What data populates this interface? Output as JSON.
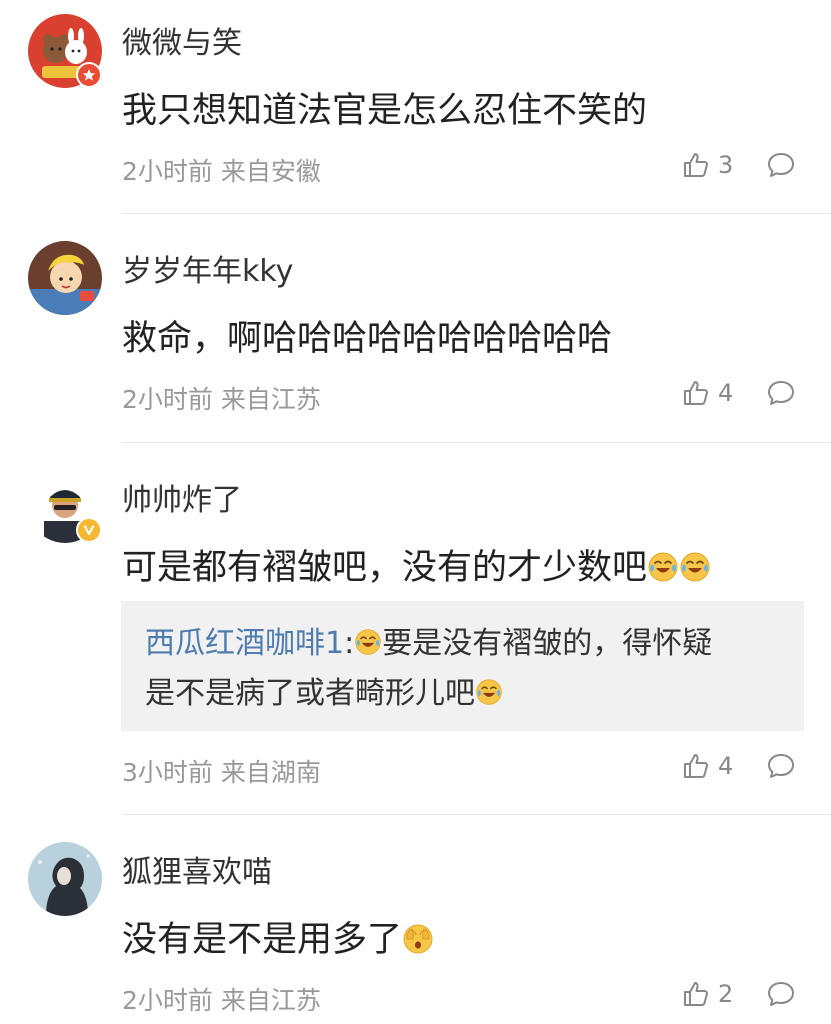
{
  "comments": [
    {
      "username": "微微与笑",
      "text": "我只想知道法官是怎么忍住不笑的",
      "time": "2小时前",
      "location": "来自安徽",
      "likes": "3",
      "avatar_icon": "bear-bunny-avatar",
      "badge_icon": "star-badge-icon",
      "badge_color": "#e94b35"
    },
    {
      "username": "岁岁年年kky",
      "text": "救命，啊哈哈哈哈哈哈哈哈哈哈",
      "time": "2小时前",
      "location": "来自江苏",
      "likes": "4",
      "avatar_icon": "cartoon-avatar"
    },
    {
      "username": "帅帅炸了",
      "text": "可是都有褶皱吧，没有的才少数吧",
      "time": "3小时前",
      "location": "来自湖南",
      "likes": "4",
      "avatar_icon": "police-avatar",
      "badge_icon": "verified-v-icon",
      "badge_color": "#f5b82e",
      "emojis": [
        "laugh-cry-emoji",
        "laugh-cry-emoji"
      ],
      "reply": {
        "user": "西瓜红酒咖啡1",
        "separator": ":",
        "line1": "要是没有褶皱的，得怀疑",
        "line2": "是不是病了或者畸形儿吧",
        "emojis": [
          "laugh-cry-emoji",
          "laugh-cry-emoji"
        ]
      }
    },
    {
      "username": "狐狸喜欢喵",
      "text": "没有是不是用多了",
      "time": "2小时前",
      "location": "来自江苏",
      "likes": "2",
      "avatar_icon": "girl-silhouette-avatar",
      "emojis": [
        "face-palm-emoji"
      ]
    }
  ],
  "colors": {
    "reply_user": "#4f7cae",
    "meta_text": "#999999",
    "quote_bg": "#f1f1f1"
  },
  "icons": {
    "like": "thumbs-up-icon",
    "reply": "comment-bubble-icon"
  }
}
